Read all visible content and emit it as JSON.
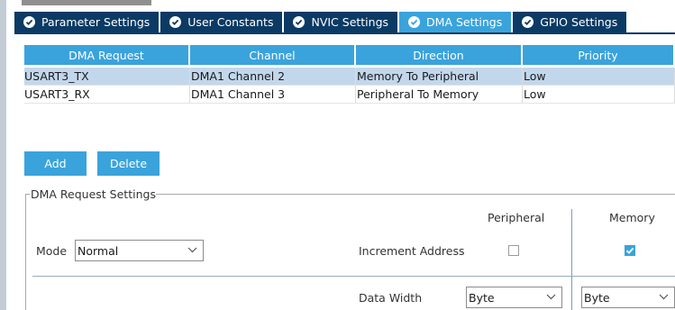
{
  "tabs": [
    {
      "label": "Parameter Settings",
      "icon": "check-circle-icon",
      "active": false
    },
    {
      "label": "User Constants",
      "icon": "check-circle-icon",
      "active": false
    },
    {
      "label": "NVIC Settings",
      "icon": "check-circle-icon",
      "active": false
    },
    {
      "label": "DMA Settings",
      "icon": "check-circle-icon",
      "active": true
    },
    {
      "label": "GPIO Settings",
      "icon": "check-circle-icon",
      "active": false
    }
  ],
  "dma_table": {
    "columns": [
      "DMA Request",
      "Channel",
      "Direction",
      "Priority"
    ],
    "rows": [
      {
        "request": "USART3_TX",
        "channel": "DMA1 Channel 2",
        "direction": "Memory To Peripheral",
        "priority": "Low",
        "selected": true
      },
      {
        "request": "USART3_RX",
        "channel": "DMA1 Channel 3",
        "direction": "Peripheral To Memory",
        "priority": "Low",
        "selected": false
      }
    ]
  },
  "buttons": {
    "add": "Add",
    "delete": "Delete"
  },
  "settings": {
    "legend": "DMA Request Settings",
    "peripheral_header": "Peripheral",
    "memory_header": "Memory",
    "mode_label": "Mode",
    "mode_value": "Normal",
    "increment_label": "Increment Address",
    "increment_peripheral_checked": false,
    "increment_memory_checked": true,
    "data_width_label": "Data Width",
    "data_width_peripheral": "Byte",
    "data_width_memory": "Byte"
  },
  "colors": {
    "tab_bg": "#0b3a64",
    "tab_active": "#3aa3dc",
    "accent": "#3aa3dc",
    "row_selected": "#c3d7ec"
  }
}
